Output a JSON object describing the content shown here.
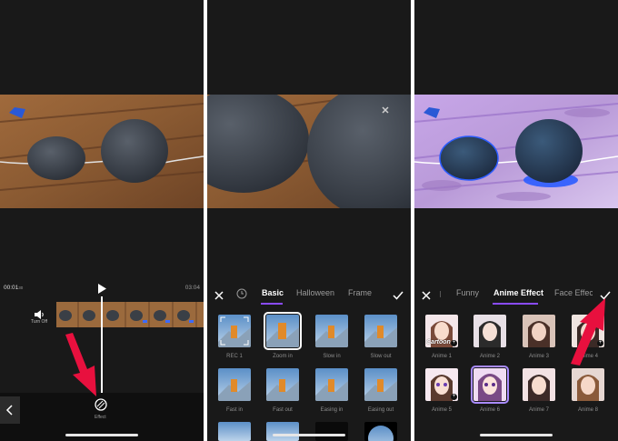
{
  "panel1": {
    "time_current": "00:01",
    "time_current_frac": "30",
    "time_total": "03:04",
    "audio_label": "Turn Off",
    "bottom_tool_label": "Effect"
  },
  "panel2": {
    "tabs": [
      "Basic",
      "Halloween",
      "Frame"
    ],
    "active_tab": "Basic",
    "effects_row1": [
      "REC 1",
      "Zoom in",
      "Slow in",
      "Slow out"
    ],
    "effects_row2": [
      "Fast in",
      "Fast out",
      "Easing in",
      "Easing out"
    ]
  },
  "panel3": {
    "tabs": [
      "Funny",
      "Anime Effect",
      "Face Effect"
    ],
    "active_tab": "Anime Effect",
    "effects_row1": [
      "Anime 1",
      "Anime 2",
      "Anime 3",
      "Anime 4"
    ],
    "effects_row2": [
      "Anime 5",
      "Anime 6",
      "Anime 7",
      "Anime 8"
    ],
    "cartoon_badge": "Cartoon"
  },
  "colors": {
    "background": "#191919",
    "accent": "#8a4bff",
    "arrow": "#e8103e",
    "glow": "#2b5cff"
  }
}
